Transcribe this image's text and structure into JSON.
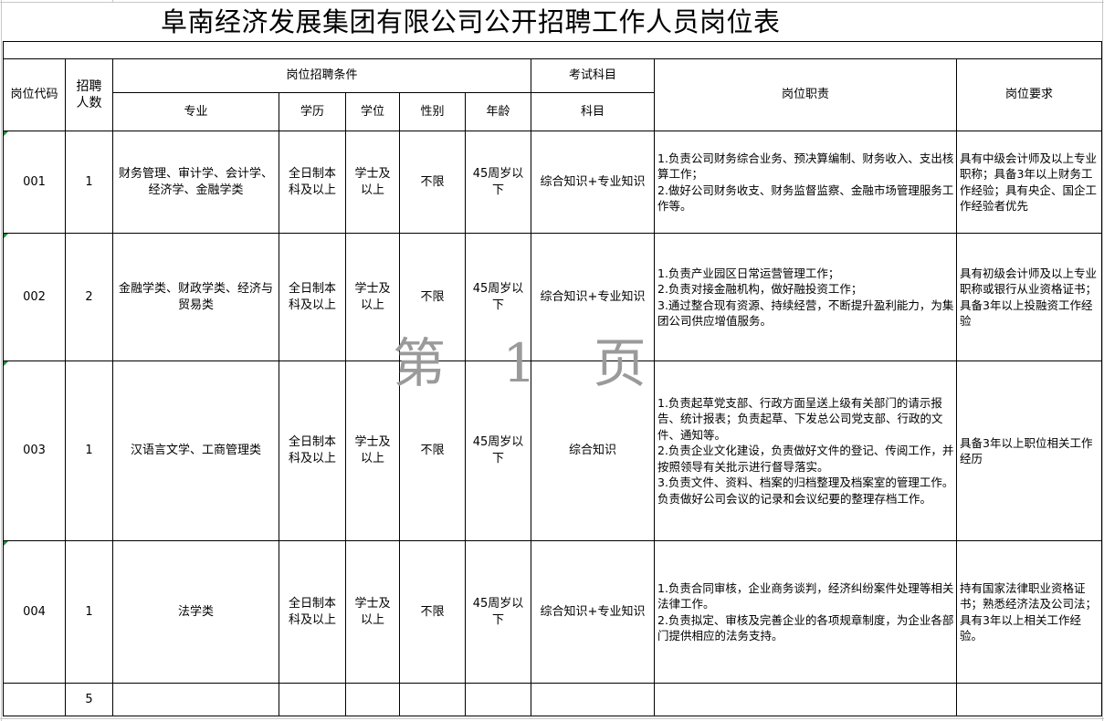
{
  "title": "阜南经济发展集团有限公司公开招聘工作人员岗位表",
  "watermark": "第 1 页",
  "headers": {
    "code": "岗位代码",
    "count": "招聘\n人数",
    "conditions": "岗位招聘条件",
    "major": "专业",
    "education": "学历",
    "degree": "学位",
    "gender": "性别",
    "age": "年龄",
    "exam_group": "考试科目",
    "exam": "科目",
    "duties": "岗位职责",
    "requirements": "岗位要求"
  },
  "rows": [
    {
      "code": "001",
      "count": "1",
      "major": "财务管理、审计学、会计学、经济学、金融学类",
      "education": "全日制本科及以上",
      "degree": "学士及以上",
      "gender": "不限",
      "age": "45周岁以下",
      "exam": "综合知识+专业知识",
      "duties": "1.负责公司财务综合业务、预决算编制、财务收入、支出核算工作；\n2.做好公司财务收支、财务监督监察、金融市场管理服务工作等。",
      "requirements": "具有中级会计师及以上专业职称；具备3年以上财务工作经验；具有央企、国企工作经验者优先"
    },
    {
      "code": "002",
      "count": "2",
      "major": "金融学类、财政学类、经济与贸易类",
      "education": "全日制本科及以上",
      "degree": "学士及以上",
      "gender": "不限",
      "age": "45周岁以下",
      "exam": "综合知识+专业知识",
      "duties": "1.负责产业园区日常运营管理工作；\n2.负责对接金融机构，做好融投资工作；\n3.通过整合现有资源、持续经营，不断提升盈利能力，为集团公司供应增值服务。",
      "requirements": "具有初级会计师及以上专业职称或银行从业资格证书；具备3年以上投融资工作经验"
    },
    {
      "code": "003",
      "count": "1",
      "major": "汉语言文学、工商管理类",
      "education": "全日制本科及以上",
      "degree": "学士及以上",
      "gender": "不限",
      "age": "45周岁以下",
      "exam": "综合知识",
      "duties": "1.负责起草党支部、行政方面呈送上级有关部门的请示报告、统计报表；负责起草、下发总公司党支部、行政的文件、通知等。\n2.负责企业文化建设，负责做好文件的登记、传阅工作，并按照领导有关批示进行督导落实。\n3.负责文件、资料、档案的归档整理及档案室的管理工作。负责做好公司会议的记录和会议纪要的整理存档工作。",
      "requirements": "具备3年以上职位相关工作经历"
    },
    {
      "code": "004",
      "count": "1",
      "major": "法学类",
      "education": "全日制本科及以上",
      "degree": "学士及以上",
      "gender": "不限",
      "age": "45周岁以下",
      "exam": "综合知识+专业知识",
      "duties": "1.负责合同审核，企业商务谈判，经济纠纷案件处理等相关法律工作。\n2.负责拟定、审核及完善企业的各项规章制度，为企业各部门提供相应的法务支持。",
      "requirements": "持有国家法律职业资格证书；熟悉经济法及公司法；具有3年以上相关工作经验。"
    }
  ],
  "total": "5",
  "colors": {
    "grid": "#000000",
    "light_grid": "#c8c8c8",
    "corner_marker": "#1d8a3a",
    "watermark": "#9a9a9a"
  }
}
